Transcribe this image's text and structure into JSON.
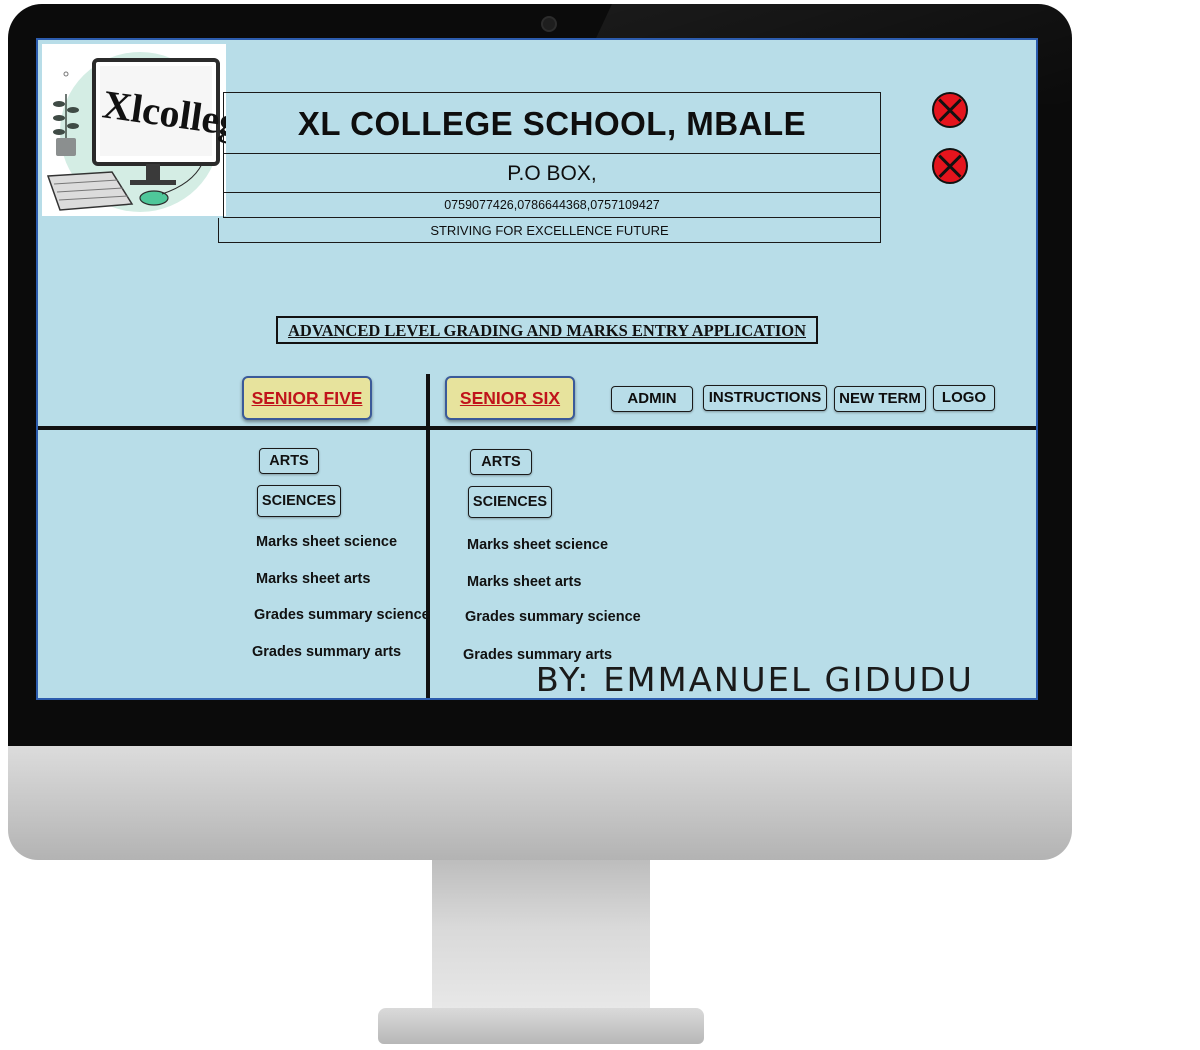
{
  "logo": {
    "text": "Xlcollege",
    "icon": "computer-illustration"
  },
  "header": {
    "school_name": "XL COLLEGE SCHOOL, MBALE",
    "address": "P.O BOX,",
    "phones": "0759077426,0786644368,0757109427",
    "motto": "STRIVING FOR EXCELLENCE FUTURE"
  },
  "window_controls": [
    "close-icon",
    "close-icon"
  ],
  "app_title": "ADVANCED LEVEL GRADING AND MARKS ENTRY APPLICATION",
  "nav": {
    "senior_five": "SENIOR FIVE",
    "senior_six": "SENIOR SIX",
    "admin": "ADMIN",
    "instructions": "INSTRUCTIONS",
    "new_term": "NEW TERM",
    "logo": "LOGO"
  },
  "senior_five_panel": {
    "arts": "ARTS",
    "sciences": "SCIENCES",
    "links": [
      "Marks sheet science",
      "Marks sheet arts",
      "Grades summary science",
      "Grades summary arts"
    ]
  },
  "senior_six_panel": {
    "arts": "ARTS",
    "sciences": "SCIENCES",
    "links": [
      "Marks sheet science",
      "Marks sheet arts",
      "Grades summary science",
      "Grades summary arts"
    ]
  },
  "byline": "BY: EMMANUEL GIDUDU",
  "colors": {
    "screen_bg": "#b8dde8",
    "senior_button_bg": "#e7e39d",
    "senior_button_text": "#c0141b",
    "close_red": "#e5141d"
  }
}
